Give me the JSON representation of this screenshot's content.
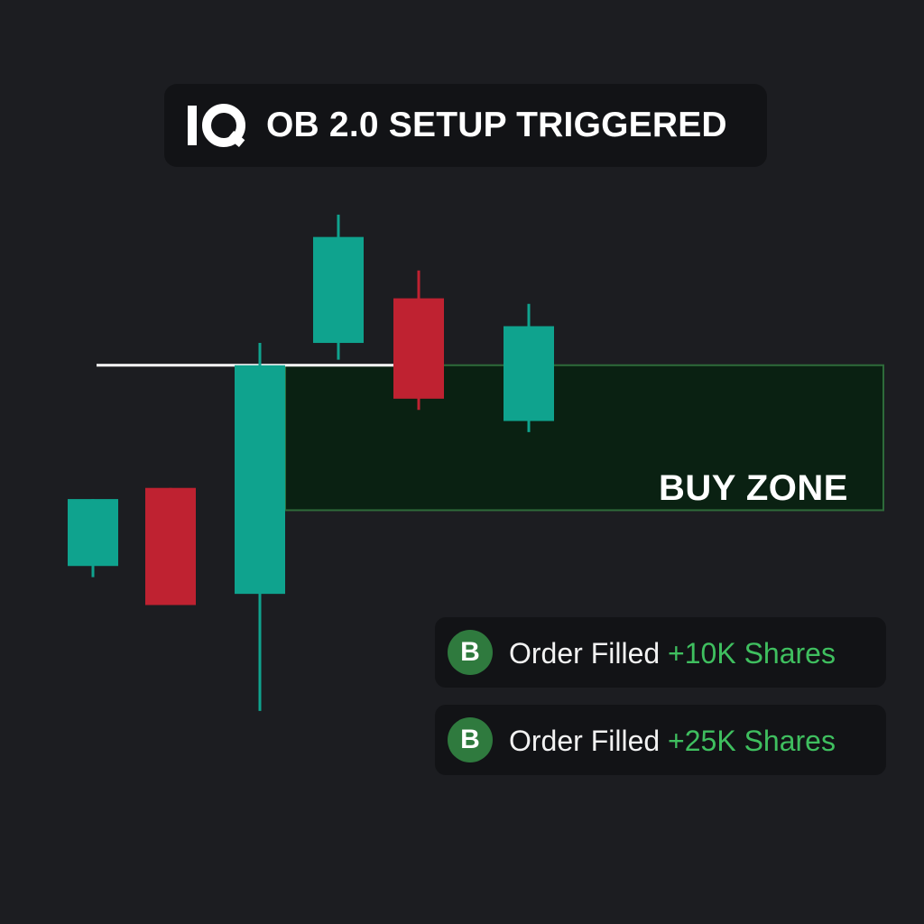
{
  "header": {
    "logo_text": "IQ",
    "title": "OB 2.0 SETUP TRIGGERED"
  },
  "colors": {
    "background": "#1c1d21",
    "panel": "#121316",
    "bullish": "#0fa38e",
    "bearish": "#bf2231",
    "zone_fill": "#0a2112",
    "zone_border": "#2e6b3a",
    "level_line": "#ffffff",
    "badge": "#2f7a3e",
    "qty_text": "#3fbf5f"
  },
  "chart_data": {
    "type": "candlestick",
    "title": "OB 2.0 SETUP TRIGGERED",
    "xlabel": "",
    "ylabel": "",
    "grid": false,
    "ylim": [
      0,
      100
    ],
    "candles": [
      {
        "open": 32.0,
        "high": 40.0,
        "low": 30.0,
        "close": 44.0,
        "direction": "up"
      },
      {
        "open": 46.0,
        "high": 46.0,
        "low": 26.0,
        "close": 25.0,
        "direction": "down"
      },
      {
        "open": 27.0,
        "high": 72.0,
        "low": 6.0,
        "close": 68.0,
        "direction": "up"
      },
      {
        "open": 72.0,
        "high": 95.0,
        "low": 69.0,
        "close": 91.0,
        "direction": "up"
      },
      {
        "open": 80.0,
        "high": 85.0,
        "low": 60.0,
        "close": 62.0,
        "direction": "down"
      },
      {
        "open": 58.0,
        "high": 79.0,
        "low": 56.0,
        "close": 75.0,
        "direction": "up"
      }
    ],
    "level_line": {
      "value": 68.0
    },
    "zone": {
      "label": "BUY ZONE",
      "top": 68.0,
      "bottom": 42.0,
      "start_candle": 2
    }
  },
  "notifications": [
    {
      "badge": "B",
      "label": "Order Filled",
      "quantity": "+10K Shares"
    },
    {
      "badge": "B",
      "label": "Order Filled",
      "quantity": "+25K Shares"
    }
  ]
}
